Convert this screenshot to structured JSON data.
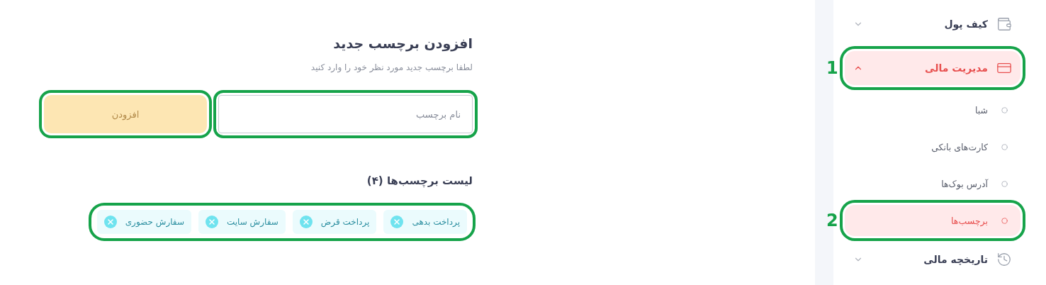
{
  "form": {
    "title": "افزودن برچسب جدید",
    "subtitle": "لطفا برچسب جدید مورد نظر خود را وارد کنید",
    "field": {
      "placeholder": "نام برچسب",
      "highlighted": true
    },
    "button": {
      "label": "افزودن",
      "highlighted": true
    }
  },
  "tag_list": {
    "title": "لیست برچسب‌ها (۴)",
    "highlighted": true,
    "tags": [
      {
        "label": "پرداخت بدهی"
      },
      {
        "label": "پرداخت قرض"
      },
      {
        "label": "سفارش سایت"
      },
      {
        "label": "سفارش حضوری"
      }
    ]
  },
  "sidebar": {
    "items": [
      {
        "kind": "group",
        "label": "کیف پول",
        "expanded": false,
        "selected": false,
        "highlighted": false
      },
      {
        "kind": "group",
        "label": "مدیریت مالی",
        "expanded": true,
        "selected": true,
        "highlighted": true,
        "marker": "1"
      },
      {
        "kind": "sub",
        "label": "شبا",
        "selected": false,
        "highlighted": false
      },
      {
        "kind": "sub",
        "label": "کارت‌های بانکی",
        "selected": false,
        "highlighted": false
      },
      {
        "kind": "sub",
        "label": "آدرس بوک‌ها",
        "selected": false,
        "highlighted": false
      },
      {
        "kind": "sub",
        "label": "برچسب‌ها",
        "selected": true,
        "highlighted": true,
        "marker": "2"
      },
      {
        "kind": "group",
        "label": "تاریخچه مالی",
        "expanded": false,
        "selected": false,
        "highlighted": false
      }
    ]
  }
}
